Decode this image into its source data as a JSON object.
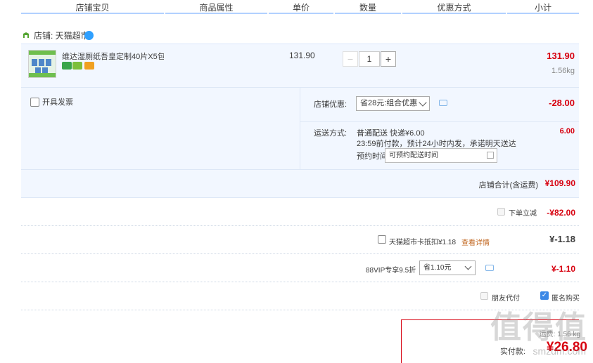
{
  "header": {
    "columns": [
      "店铺宝贝",
      "商品属性",
      "单价",
      "数量",
      "优惠方式",
      "小计"
    ]
  },
  "shop": {
    "label": "店铺: 天猫超市"
  },
  "item": {
    "title": "维达湿厕纸吾皇定制40片X5包...",
    "unit_price": "131.90",
    "quantity": "1",
    "minus": "−",
    "plus": "+",
    "subtotal": "131.90",
    "weight": "1.56kg"
  },
  "options": {
    "invoice_label": "开具发票",
    "shop_discount_label": "店铺优惠:",
    "shop_discount_select": "省28元:组合优惠",
    "shop_discount_value": "-28.00",
    "shipping_label": "运送方式:",
    "shipping_method": "普通配送 快递¥6.00",
    "shipping_note": "23:59前付款，预计24小时内发，承诺明天送达",
    "appointment_label": "预约时间",
    "appointment_placeholder": "可预约配送时间",
    "shipping_value": "6.00"
  },
  "shop_total": {
    "label": "店铺合计(含运费)",
    "value": "¥109.90"
  },
  "instant_discount": {
    "label": "下单立减",
    "value": "-¥82.00"
  },
  "tmall_card": {
    "label": "天猫超市卡抵扣¥1.18",
    "link": "查看详情",
    "value": "¥-1.18"
  },
  "vip": {
    "label": "88VIP专享9.5折",
    "select": "省1.10元",
    "value": "¥-1.10"
  },
  "checkout_opts": {
    "friend_pay": "朋友代付",
    "anonymous": "匿名购买"
  },
  "final": {
    "sub_text": "运费: 1.56 kg",
    "label": "实付款:",
    "amount": "¥26.80"
  },
  "watermark": {
    "main": "值得值",
    "sub": "smzdm.com"
  },
  "colors": {
    "price_red": "#d7000f",
    "header_line": "#b2d1ff",
    "panel_bg": "#f2f7ff",
    "checkbox_blue": "#3a87e6",
    "link_orange": "#c0641c"
  }
}
